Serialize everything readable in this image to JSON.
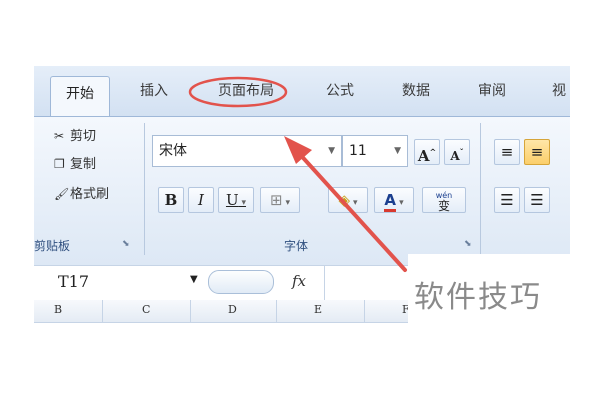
{
  "tabs": [
    "开始",
    "插入",
    "页面布局",
    "公式",
    "数据",
    "审阅",
    "视"
  ],
  "clipboard": {
    "cut": "剪切",
    "copy": "复制",
    "painter": "格式刷",
    "label": "剪贴板"
  },
  "font": {
    "name": "宋体",
    "size": "11",
    "grow": "A",
    "shrink": "A",
    "bold": "B",
    "italic": "I",
    "underline": "U",
    "font_color": "A",
    "phonetic": "wén",
    "phonetic_char": "变",
    "label": "字体"
  },
  "formula_bar": {
    "cell_ref": "T17",
    "fx": "fx"
  },
  "columns": [
    "B",
    "C",
    "D",
    "E",
    "F"
  ],
  "watermark": "软件技巧",
  "colors": {
    "highlight_oval": "#e2534c",
    "arrow": "#e2534c",
    "font_color_bar": "#d83a2f"
  }
}
